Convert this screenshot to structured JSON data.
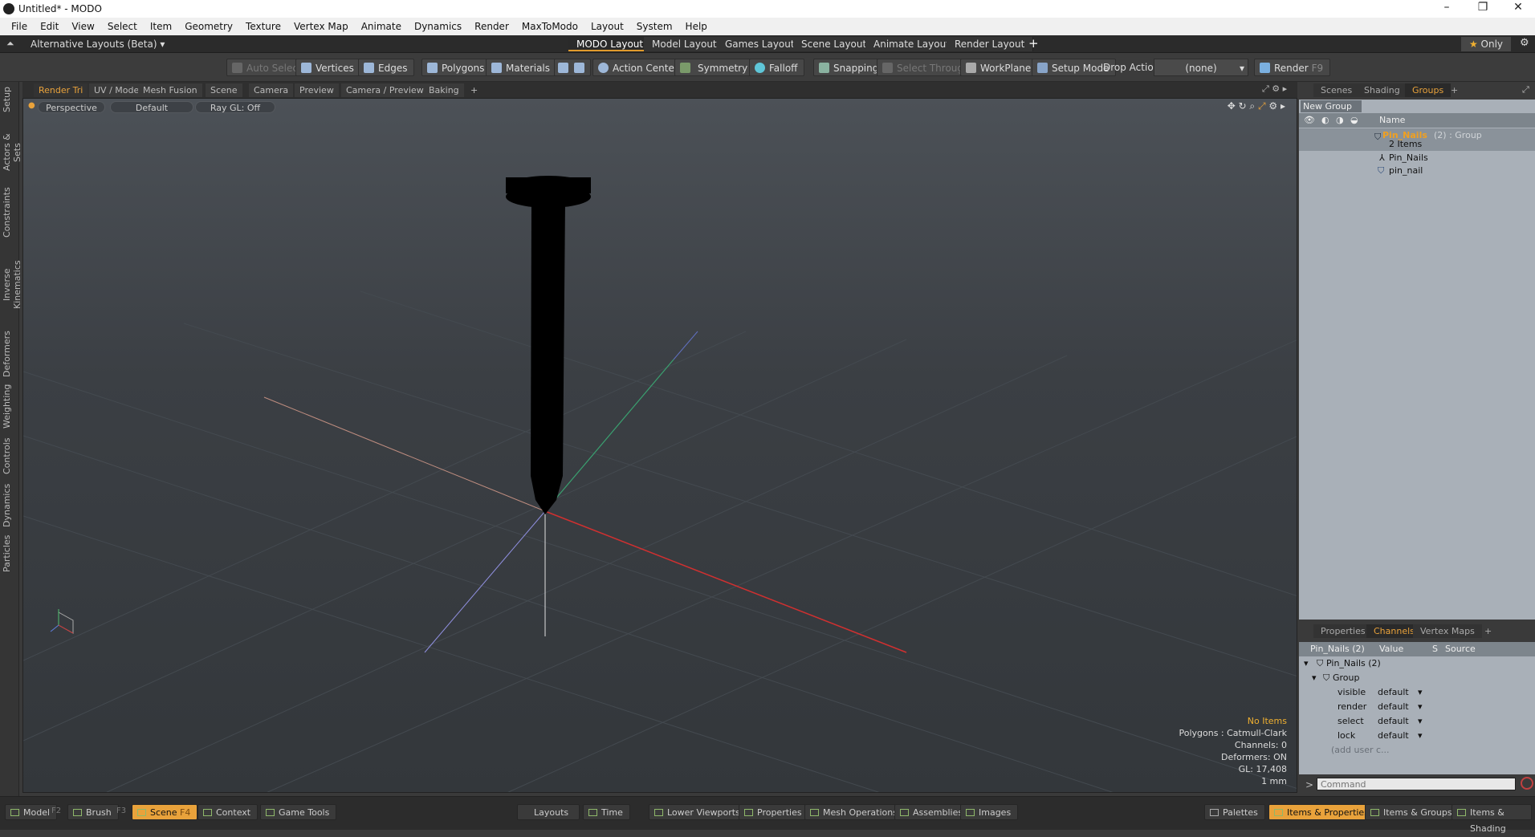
{
  "window": {
    "title": "Untitled* - MODO"
  },
  "menu": [
    "File",
    "Edit",
    "View",
    "Select",
    "Item",
    "Geometry",
    "Texture",
    "Vertex Map",
    "Animate",
    "Dynamics",
    "Render",
    "MaxToModo",
    "Layout",
    "System",
    "Help"
  ],
  "layouts": {
    "alt_label": "Alternative Layouts (Beta)",
    "tabs": [
      "MODO Layout",
      "Model Layout",
      "Games Layout",
      "Scene Layout",
      "Animate Layout",
      "Render Layout"
    ],
    "plus": "+",
    "only_label": "Only"
  },
  "toolbar": {
    "auto_select": "Auto Select",
    "vertices": "Vertices",
    "edges": "Edges",
    "polygons": "Polygons",
    "materials": "Materials",
    "action_center": "Action Center",
    "symmetry": "Symmetry",
    "falloff": "Falloff",
    "snapping": "Snapping",
    "select_through": "Select Through",
    "workplane": "WorkPlane",
    "setup_mode": "Setup Mode",
    "drop_action": "Drop Action",
    "drop_value": "(none)",
    "render": "Render",
    "render_key": "F9"
  },
  "side_tabs": [
    "Setup",
    "Actors & Sets",
    "Constraints",
    "Inverse Kinematics",
    "Deformers",
    "Weighting",
    "Controls",
    "Dynamics",
    "Particles"
  ],
  "viewport_tabs": [
    "Render Tri",
    "UV / Model",
    "Mesh Fusion",
    "Scene",
    "Camera",
    "Preview",
    "Camera / Preview",
    "Baking",
    "+"
  ],
  "viewport": {
    "view": "Perspective",
    "shading": "Default",
    "raygl": "Ray GL: Off"
  },
  "info": {
    "no_items": "No Items",
    "polygons": "Polygons : Catmull-Clark",
    "channels": "Channels: 0",
    "deformers": "Deformers: ON",
    "gl": "GL: 17,408",
    "scale": "1 mm"
  },
  "right_tabs": [
    "Scenes",
    "Shading",
    "Groups",
    "+"
  ],
  "groups": {
    "new_group": "New Group",
    "col_name": "Name",
    "root_name": "Pin_Nails",
    "root_suffix": "(2) : Group",
    "root_count": "2 Items",
    "child1": "Pin_Nails",
    "child2": "pin_nail"
  },
  "chan_tabs": [
    "Properties",
    "Channels",
    "Vertex Maps",
    "+"
  ],
  "channels": {
    "header_item": "Pin_Nails (2)",
    "header_value": "Value",
    "header_s": "S",
    "header_source": "Source",
    "root": "Pin_Nails (2)",
    "group": "Group",
    "rows": [
      {
        "name": "visible",
        "value": "default"
      },
      {
        "name": "render",
        "value": "default"
      },
      {
        "name": "select",
        "value": "default"
      },
      {
        "name": "lock",
        "value": "default"
      }
    ],
    "add_user": "(add user c..."
  },
  "command": {
    "placeholder": "Command"
  },
  "statusbar": {
    "model": "Model",
    "model_key": "F2",
    "brush": "Brush",
    "brush_key": "F3",
    "scene": "Scene",
    "scene_key": "F4",
    "context": "Context",
    "game_tools": "Game Tools",
    "layouts": "Layouts",
    "time": "Time",
    "lower_viewports": "Lower Viewports",
    "properties": "Properties",
    "mesh_operations": "Mesh Operations",
    "assemblies": "Assemblies",
    "images": "Images",
    "palettes": "Palettes",
    "items_properties": "Items & Properties",
    "items_groups": "Items & Groups",
    "items_shading": "Items & Shading"
  }
}
